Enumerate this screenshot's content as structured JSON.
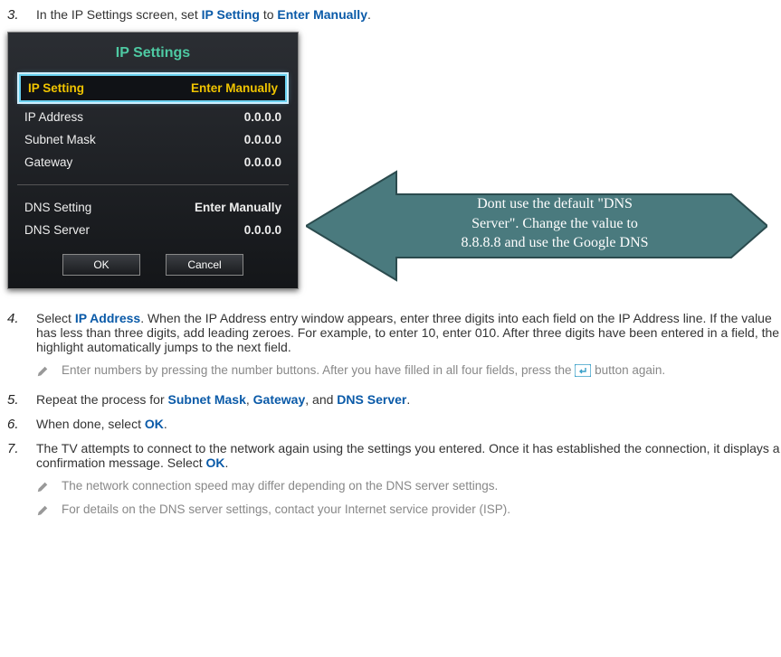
{
  "steps": {
    "s3": {
      "num": "3.",
      "textA": "In the IP Settings screen, set ",
      "kw1": "IP Setting",
      "textB": " to ",
      "kw2": "Enter Manually",
      "textC": "."
    },
    "s4": {
      "num": "4.",
      "textA": "Select ",
      "kw1": "IP Address",
      "textB": ". When the IP Address entry window appears, enter three digits into each field on the IP Address line. If the value has less than three digits, add leading zeroes. For example, to enter 10, enter 010. After three digits have been entered in a field, the highlight automatically jumps to the next field."
    },
    "s5": {
      "num": "5.",
      "textA": "Repeat the process for ",
      "kw1": "Subnet Mask",
      "sep1": ", ",
      "kw2": "Gateway",
      "sep2": ", and ",
      "kw3": "DNS Server",
      "textEnd": "."
    },
    "s6": {
      "num": "6.",
      "textA": "When done, select ",
      "kw1": "OK",
      "textEnd": "."
    },
    "s7": {
      "num": "7.",
      "textA": "The TV attempts to connect to the network again using the settings you entered. Once it has established the connection, it displays a confirmation message. Select ",
      "kw1": "OK",
      "textEnd": "."
    }
  },
  "notes": {
    "n1": {
      "textA": "Enter numbers by pressing the number buttons. After you have filled in all four fields, press the ",
      "textB": " button again."
    },
    "n2": "The network connection speed may differ depending on the DNS server settings.",
    "n3": "For details on the DNS server settings, contact your Internet service provider (ISP)."
  },
  "panel": {
    "title": "IP Settings",
    "rows": {
      "ipSetting": {
        "label": "IP Setting",
        "value": "Enter Manually"
      },
      "ipAddress": {
        "label": "IP Address",
        "value": "0.0.0.0"
      },
      "subnet": {
        "label": "Subnet Mask",
        "value": "0.0.0.0"
      },
      "gateway": {
        "label": "Gateway",
        "value": "0.0.0.0"
      },
      "dnsSetting": {
        "label": "DNS Setting",
        "value": "Enter Manually"
      },
      "dnsServer": {
        "label": "DNS Server",
        "value": "0.0.0.0"
      }
    },
    "ok": "OK",
    "cancel": "Cancel"
  },
  "arrow": {
    "line1": "Dont use the default \"DNS",
    "line2": "Server\". Change the value to",
    "line3": "8.8.8.8 and use the Google DNS"
  }
}
